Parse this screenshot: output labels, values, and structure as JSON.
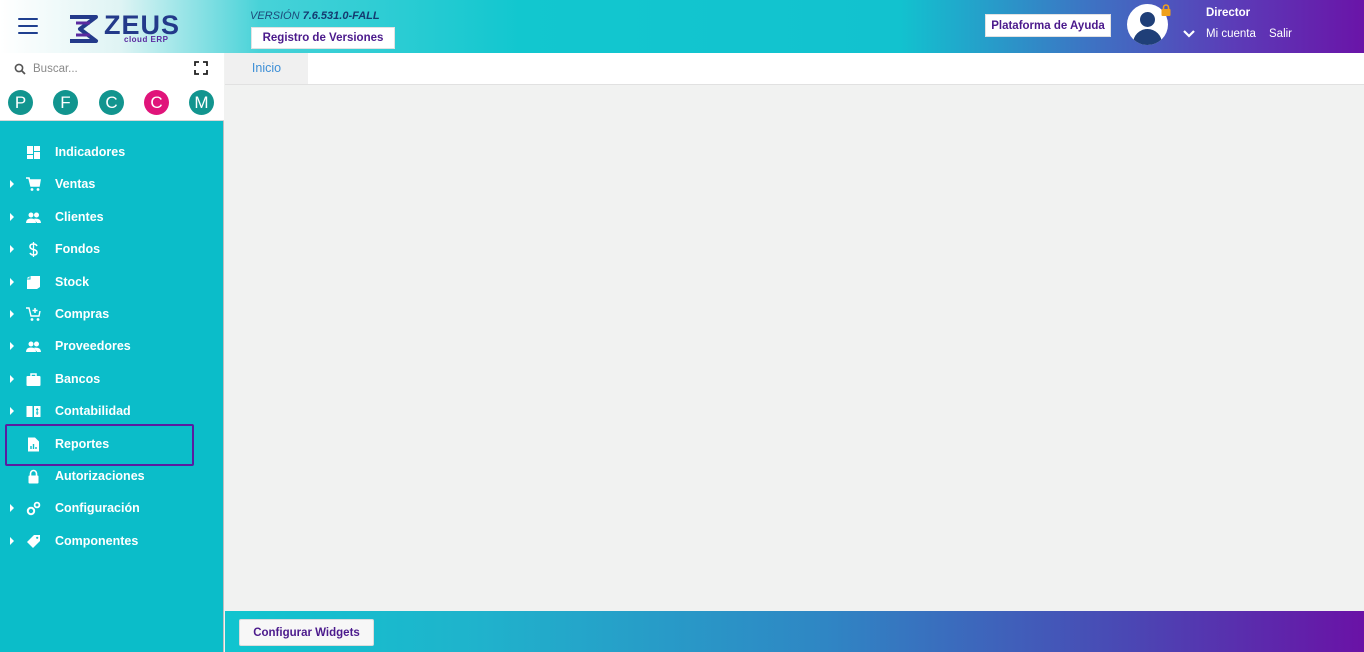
{
  "header": {
    "logo_text": "ZEUS",
    "logo_sub": "cloud ERP",
    "version_label": "VERSIÓN",
    "version_number": "7.6.531.0-FALL",
    "registro_button": "Registro de Versiones",
    "ayuda_button": "Plataforma de Ayuda",
    "user_role": "Director",
    "mi_cuenta": "Mi cuenta",
    "salir": "Salir"
  },
  "sidebar": {
    "search_placeholder": "Buscar...",
    "quick_access": [
      {
        "letter": "P",
        "color": "#12958f"
      },
      {
        "letter": "F",
        "color": "#12958f"
      },
      {
        "letter": "C",
        "color": "#12958f"
      },
      {
        "letter": "C",
        "color": "#e0147a"
      },
      {
        "letter": "M",
        "color": "#12958f"
      }
    ],
    "items": [
      {
        "label": "Indicadores",
        "icon": "dashboard-icon",
        "expandable": false
      },
      {
        "label": "Ventas",
        "icon": "cart-icon",
        "expandable": true
      },
      {
        "label": "Clientes",
        "icon": "people-icon",
        "expandable": true
      },
      {
        "label": "Fondos",
        "icon": "dollar-icon",
        "expandable": true
      },
      {
        "label": "Stock",
        "icon": "stock-icon",
        "expandable": true
      },
      {
        "label": "Compras",
        "icon": "cart-plus-icon",
        "expandable": true
      },
      {
        "label": "Proveedores",
        "icon": "people-icon",
        "expandable": true
      },
      {
        "label": "Bancos",
        "icon": "briefcase-icon",
        "expandable": true
      },
      {
        "label": "Contabilidad",
        "icon": "ledger-icon",
        "expandable": true
      },
      {
        "label": "Reportes",
        "icon": "report-icon",
        "expandable": false,
        "selected": true
      },
      {
        "label": "Autorizaciones",
        "icon": "lock-icon",
        "expandable": false
      },
      {
        "label": "Configuración",
        "icon": "gears-icon",
        "expandable": true
      },
      {
        "label": "Componentes",
        "icon": "tag-icon",
        "expandable": true
      }
    ]
  },
  "tabs": [
    {
      "label": "Inicio"
    }
  ],
  "footer": {
    "configurar_button": "Configurar Widgets"
  },
  "colors": {
    "sidebar": "#0bbdc9",
    "accent": "#5a1ca0",
    "tab_text": "#3d8fd6"
  }
}
